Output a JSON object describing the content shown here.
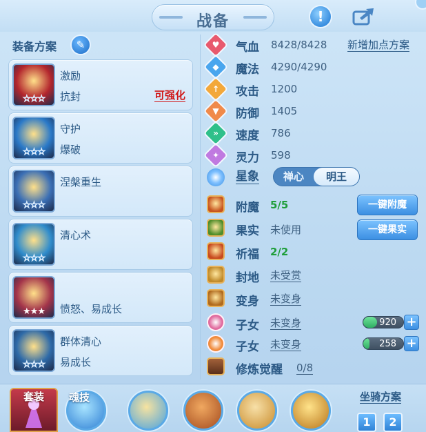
{
  "header": {
    "title": "战备"
  },
  "left": {
    "scheme_title": "装备方案",
    "equipment": [
      {
        "name": "激励",
        "sub": "抗封",
        "tag": "可强化",
        "stars": "☆☆☆",
        "stars_filled": false,
        "color": "#b3262d"
      },
      {
        "name": "守护",
        "sub": "爆破",
        "tag": "",
        "stars": "☆☆☆",
        "stars_filled": false,
        "color": "#2a79c8"
      },
      {
        "name": "涅槃重生",
        "sub": "",
        "tag": "",
        "stars": "☆☆☆",
        "stars_filled": false,
        "color": "#3b6fb5"
      },
      {
        "name": "清心术",
        "sub": "",
        "tag": "",
        "stars": "☆☆☆",
        "stars_filled": false,
        "color": "#2f8ccc"
      },
      {
        "name": "",
        "sub": "愤怒、易成长",
        "tag": "",
        "stars": "★★★",
        "stars_filled": true,
        "color": "#a3344a"
      },
      {
        "name": "群体清心",
        "sub": "易成长",
        "tag": "",
        "stars": "☆☆☆",
        "stars_filled": false,
        "color": "#2e6aa8"
      }
    ]
  },
  "stats": {
    "new_plan": "新增加点方案",
    "items": [
      {
        "label": "气血",
        "value": "8428/8428",
        "color": "#e85a6e",
        "icon": "heart-icon",
        "glyph": "♥"
      },
      {
        "label": "魔法",
        "value": "4290/4290",
        "color": "#4aa6ee",
        "icon": "mana-icon",
        "glyph": "◆"
      },
      {
        "label": "攻击",
        "value": "1200",
        "color": "#f3a83a",
        "icon": "attack-icon",
        "glyph": "↑"
      },
      {
        "label": "防御",
        "value": "1405",
        "color": "#f08a4a",
        "icon": "defense-icon",
        "glyph": "▼"
      },
      {
        "label": "速度",
        "value": "786",
        "color": "#2fc08a",
        "icon": "speed-icon",
        "glyph": "»"
      },
      {
        "label": "灵力",
        "value": "598",
        "color": "#c07ae0",
        "icon": "spirit-icon",
        "glyph": "✦"
      }
    ]
  },
  "constellation": {
    "label": "星象",
    "options": [
      "禅心",
      "明王"
    ]
  },
  "rows": [
    {
      "label": "附魔",
      "value": "5/5",
      "style": "green",
      "color": "#c8551e"
    },
    {
      "label": "果实",
      "value": "未使用",
      "style": "plain",
      "color": "#4f8d2a"
    },
    {
      "label": "祈福",
      "value": "2/2",
      "style": "green",
      "color": "#c84a1e"
    },
    {
      "label": "封地",
      "value": "未受赏",
      "style": "ul",
      "color": "#c08a2a"
    },
    {
      "label": "变身",
      "value": "未变身",
      "style": "ul",
      "color": "#b06a1e"
    }
  ],
  "buttons": {
    "enchant": "一键附魔",
    "fruit": "一键果实"
  },
  "children": [
    {
      "label": "子女",
      "value": "未变身",
      "bar": "920",
      "fill": 0.35,
      "color": "#e06a9e"
    },
    {
      "label": "子女",
      "value": "未变身",
      "bar": "258",
      "fill": 0.15,
      "color": "#f08a3a"
    }
  ],
  "cultivation": {
    "label": "修炼觉醒",
    "value": "0/8"
  },
  "bottom": {
    "set_label": "套装",
    "skill_label": "魂技",
    "mount_label": "坐骑方案",
    "mount_buttons": [
      "1",
      "2"
    ]
  }
}
